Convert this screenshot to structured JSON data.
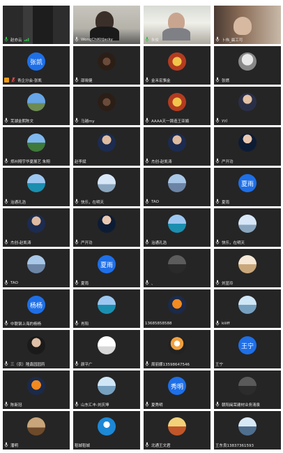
{
  "participants": [
    {
      "name": "赵亦云",
      "type": "video",
      "variant": "v1",
      "mic": "speaking",
      "signal": true
    },
    {
      "name": "WongChiKitJacky",
      "type": "video",
      "variant": "v2",
      "mic": "on"
    },
    {
      "name": "朱俊",
      "type": "video",
      "variant": "v3",
      "mic": "speaking",
      "speaking": true
    },
    {
      "name": "卜伟_晨工可",
      "type": "video",
      "variant": "v4",
      "mic": "on"
    },
    {
      "name": "青企分会-张凯",
      "type": "text",
      "avatar_text": "张凯",
      "mic": "muted",
      "badge": "host-icon"
    },
    {
      "name": "邵晓健",
      "type": "pic",
      "pic": "pic2",
      "mic": "on"
    },
    {
      "name": "金禾宏骆金",
      "type": "pic",
      "pic": "pic3",
      "mic": "on"
    },
    {
      "name": "张燃",
      "type": "pic",
      "pic": "pic4",
      "mic": "on"
    },
    {
      "name": "芜湖金熙陈文",
      "type": "pic",
      "pic": "pic5",
      "mic": "on"
    },
    {
      "name": "马越my",
      "type": "pic",
      "pic": "pic2",
      "mic": "on"
    },
    {
      "name": "AAAA天一铸造王亚娟",
      "type": "pic",
      "pic": "pic3",
      "mic": "on"
    },
    {
      "name": "yyj",
      "type": "pic",
      "pic": "pic6",
      "mic": "on"
    },
    {
      "name": "郑州翔宇华夏展艺 朱翔",
      "type": "pic",
      "pic": "pic7",
      "mic": "on"
    },
    {
      "name": "赵李斌",
      "type": "pic",
      "pic": "pic8",
      "mic": "none"
    },
    {
      "name": "杰创-赵凯涛",
      "type": "pic",
      "pic": "pic8",
      "mic": "on"
    },
    {
      "name": "严开功",
      "type": "pic",
      "pic": "pic11",
      "mic": "on"
    },
    {
      "name": "治通孔浩",
      "type": "pic",
      "pic": "pic9",
      "mic": "on"
    },
    {
      "name": "快乐，在明天",
      "type": "pic",
      "pic": "pic10",
      "mic": "on"
    },
    {
      "name": "TAO",
      "type": "pic",
      "pic": "pic12",
      "mic": "on"
    },
    {
      "name": "夏雨",
      "type": "text",
      "avatar_text": "夏雨",
      "mic": "on"
    },
    {
      "name": "杰创-赵凯涛",
      "type": "pic",
      "pic": "pic8",
      "mic": "on"
    },
    {
      "name": "严开功",
      "type": "pic",
      "pic": "pic11",
      "mic": "on"
    },
    {
      "name": "治通孔浩",
      "type": "pic",
      "pic": "pic9",
      "mic": "on"
    },
    {
      "name": "快乐，在明天",
      "type": "pic",
      "pic": "pic10",
      "mic": "on"
    },
    {
      "name": "TAO",
      "type": "pic",
      "pic": "pic12",
      "mic": "on"
    },
    {
      "name": "夏雨",
      "type": "text",
      "avatar_text": "夏雨",
      "mic": "on"
    },
    {
      "name": "、",
      "type": "pic",
      "pic": "pic15",
      "mic": "on"
    },
    {
      "name": "刘显玲",
      "type": "pic",
      "pic": "pic16",
      "mic": "on"
    },
    {
      "name": "中联钢上海的杨杨",
      "type": "text",
      "avatar_text": "杨杨",
      "mic": "on"
    },
    {
      "name": "肖阳",
      "type": "pic",
      "pic": "pic9",
      "mic": "on"
    },
    {
      "name": "13685858588",
      "type": "pic",
      "pic": "pic17",
      "mic": "none"
    },
    {
      "name": "kiiiff",
      "type": "pic",
      "pic": "pic18",
      "mic": "on"
    },
    {
      "name": "三（农）隆鑫园园药",
      "type": "pic",
      "pic": "pic20",
      "mic": "on"
    },
    {
      "name": "颜平广",
      "type": "pic",
      "pic": "pic14",
      "mic": "on"
    },
    {
      "name": "周丽娜13598647546",
      "type": "pic",
      "pic": "pic21",
      "mic": "on"
    },
    {
      "name": "王宁",
      "type": "text",
      "avatar_text": "王宁",
      "mic": "none"
    },
    {
      "name": "陈新冠",
      "type": "pic",
      "pic": "pic17",
      "mic": "on"
    },
    {
      "name": "山东汇丰-刘庆坤",
      "type": "pic",
      "pic": "pic18",
      "mic": "on"
    },
    {
      "name": "夏秀明",
      "type": "text",
      "avatar_text": "秀明",
      "mic": "on"
    },
    {
      "name": "朝阳闽荣建材业务清泉",
      "type": "pic",
      "pic": "pic24",
      "mic": "on"
    },
    {
      "name": "潘明",
      "type": "pic",
      "pic": "pic23",
      "mic": "on"
    },
    {
      "name": "稻城稻城",
      "type": "pic",
      "pic": "pic22",
      "mic": "none"
    },
    {
      "name": "北通王文君",
      "type": "pic",
      "pic": "pic25",
      "mic": "on"
    },
    {
      "name": "王东良13837361593",
      "type": "pic",
      "pic": "pic26",
      "mic": "none"
    }
  ]
}
